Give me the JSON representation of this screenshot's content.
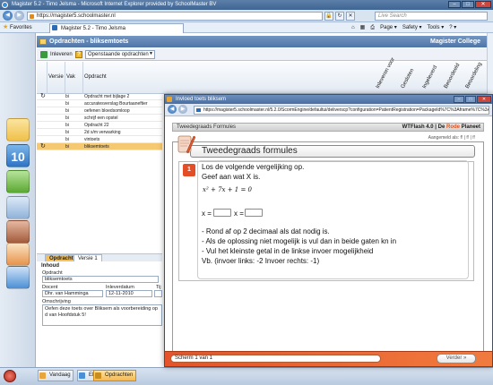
{
  "browser": {
    "title": "Magister 5.2 - Timo Jelsma - Microsoft Internet Explorer provided by SchoolMaster BV",
    "address": "https://magister5.schoolmaster.nl",
    "search_placeholder": "Live Search",
    "favorites_label": "Favorites",
    "tab_label": "Magister 5.2 - Timo Jelsma",
    "cmd": {
      "page": "Page ▾",
      "safety": "Safety ▾",
      "tools": "Tools ▾",
      "help": "? ▾"
    }
  },
  "app": {
    "header_title": "Opdrachten - bliksemtoets",
    "school": "Magister College",
    "toolbar": {
      "inleveren_label": "Inleveren",
      "filter_value": "Openstaande opdrachten"
    },
    "rail": {
      "calendar_number": "10"
    },
    "grid": {
      "columns": {
        "versie": "Versie",
        "vak": "Vak",
        "opdracht": "Opdracht"
      },
      "rotated_columns": [
        "Inleveren voor",
        "Gesloten",
        "Ingeleverd",
        "Beoordeeld",
        "Beoordeling"
      ],
      "rows": [
        {
          "vak": "bi",
          "opdracht": "Opdracht met bijlage 2"
        },
        {
          "vak": "bi",
          "opdracht": "accuratesverslag Bourtaaneftier"
        },
        {
          "vak": "bi",
          "opdracht": "oefenen bloedsomloop"
        },
        {
          "vak": "bi",
          "opdracht": "schrijf een opstel"
        },
        {
          "vak": "bi",
          "opdracht": "Opdracht 22"
        },
        {
          "vak": "bi",
          "opdracht": "2d s/m verwarking"
        },
        {
          "vak": "bi",
          "opdracht": "vintoets"
        },
        {
          "vak": "bi",
          "opdracht": "bliksemtoets"
        }
      ]
    },
    "detail": {
      "tabs": [
        "Opdracht",
        "Versie 1"
      ],
      "inhoud_label": "Inhoud",
      "opdracht_label": "Opdracht",
      "opdracht_value": "bliksemtoets",
      "docent_label": "Docent",
      "docent_value": "Dhr. van Hamminga",
      "inleverdatum_label": "Inleverdatum",
      "inleverdatum_value": "12-11-2010",
      "tijd_label": "Tij",
      "omschrijving_label": "Omschrijving",
      "omschrijving_value": "Oefen deze toets over Bliksem als voorbereiding op d van Hoofdstuk 5!"
    }
  },
  "taskbar": {
    "items": [
      "Vandaag",
      "ELO",
      "Opdrachten"
    ]
  },
  "popup": {
    "title": "Invloed toets bliksem",
    "address": "https://magister5.schoolmaster.nl/5.2.0/ScormEngine/defaultui/deliverscp?configuration=PatientRegistration=PackageId%7C%3Aframe%7C%3Aname%7C%3Aoptions%7Caspx%7C%3Abis",
    "wt_left": "Tweedegraads Formules",
    "wt_brand_a": "WTFlash 4.0 |",
    "wt_brand_b": "De",
    "wt_brand_c": "Rode",
    "wt_brand_d": "Planeet",
    "aangemeld": "Aangemeld als: f! | f! | f!",
    "section_title": "Tweedegraads formules",
    "question_number": "1",
    "question_lines": [
      "Los de volgende vergelijking op.",
      "Geef aan wat X is."
    ],
    "formula": "x² + 7x + 1 = 0",
    "x_label_1": "x =",
    "x_label_2": "x =",
    "instructions": [
      "- Rond af op 2 decimaal als dat nodig is.",
      "- Als de oplossing niet mogelijk is vul dan in beide gaten kn in",
      "- Vul het kleinste getal in de linkse invoer mogelijkheid",
      "Vb. (invoer links: -2     Invoer rechts: -1)"
    ],
    "scherm_label": "Scherm 1 van 1",
    "verder_label": "Verder »"
  }
}
